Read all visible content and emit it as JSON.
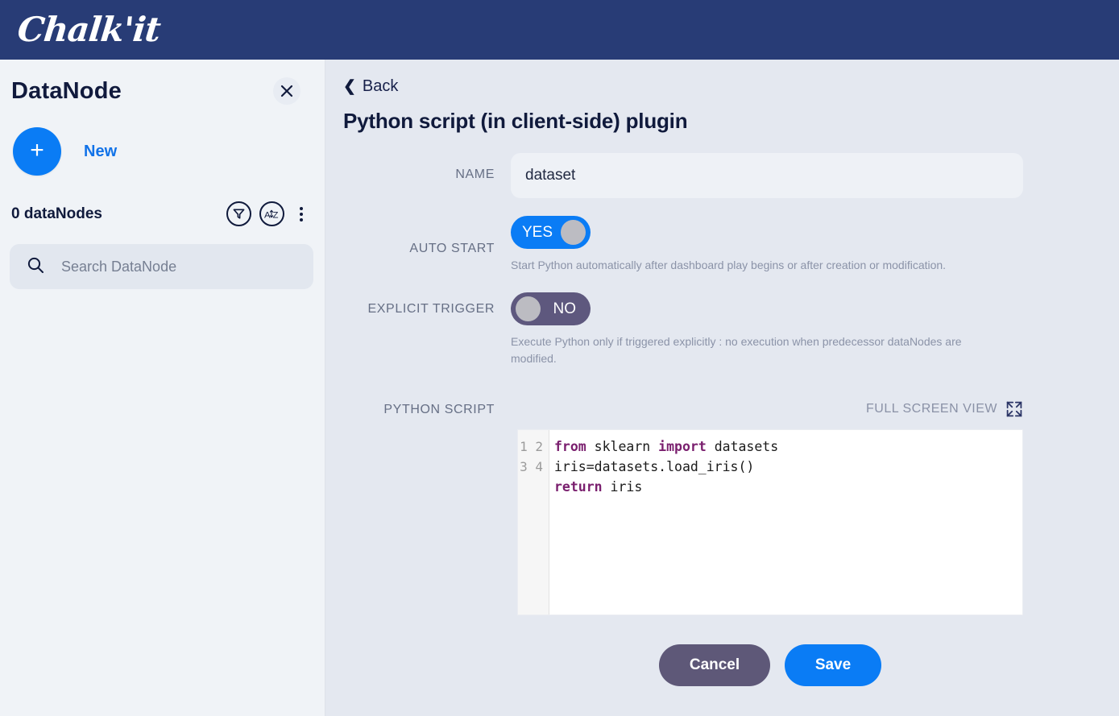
{
  "app": {
    "brand": "Chalk'it",
    "brand_color": "#283c76"
  },
  "sidebar": {
    "title": "DataNode",
    "close_icon": "close-icon",
    "new_button": {
      "plus": "+",
      "label": "New"
    },
    "count_label": "0 dataNodes",
    "filter_icon": "filter-funnel-icon",
    "sort_icon": "sort-az-icon",
    "more_icon": "kebab-menu-icon",
    "search": {
      "icon": "search-icon",
      "value": "",
      "placeholder": "Search DataNode"
    }
  },
  "main": {
    "back_label": "Back",
    "back_icon": "chevron-left-icon",
    "title": "Python script (in client-side) plugin",
    "fields": {
      "name": {
        "label": "NAME",
        "value": "dataset",
        "placeholder": "Name"
      },
      "auto_start": {
        "label": "AUTO START",
        "toggle_value": "YES",
        "state": "on",
        "hint": "Start Python automatically after dashboard play begins or after creation or modification."
      },
      "explicit_trigger": {
        "label": "EXPLICIT TRIGGER",
        "toggle_value": "NO",
        "state": "off",
        "hint": "Execute Python only if triggered explicitly : no execution when predecessor dataNodes are modified."
      },
      "python_script": {
        "label": "PYTHON SCRIPT",
        "fullscreen_label": "FULL SCREEN VIEW",
        "fullscreen_icon": "expand-fullscreen-icon",
        "line_numbers": "1\n2\n3\n4",
        "code_lines": [
          "from sklearn import datasets",
          "iris=datasets.load_iris()",
          "return iris",
          ""
        ],
        "keyword_color": "#7a1f6e"
      }
    },
    "actions": {
      "cancel_label": "Cancel",
      "save_label": "Save",
      "cancel_color": "#5e5878",
      "save_color": "#0a7cf5"
    }
  }
}
